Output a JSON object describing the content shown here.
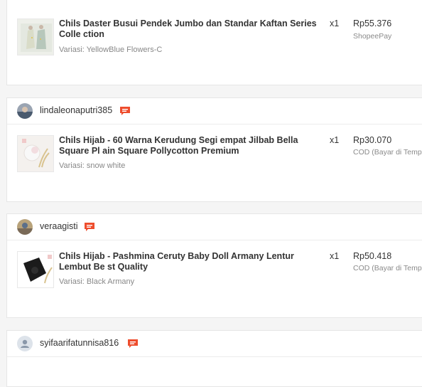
{
  "orders": [
    {
      "product_name": "Chils Daster Busui Pendek Jumbo dan Standar Kaftan Series Colle ction",
      "variant": "Variasi: YellowBlue Flowers-C",
      "qty": "x1",
      "price": "Rp55.376",
      "payment": "ShopeePay"
    },
    {
      "username": "lindaleonaputri385",
      "product_name": "Chils Hijab - 60 Warna Kerudung Segi empat Jilbab Bella Square Pl ain Square Pollycotton Premium",
      "variant": "Variasi: snow white",
      "qty": "x1",
      "price": "Rp30.070",
      "payment": "COD (Bayar di Tempat)"
    },
    {
      "username": "veraagisti",
      "product_name": "Chils Hijab - Pashmina Ceruty Baby Doll Armany Lentur Lembut Be st Quality",
      "variant": "Variasi: Black Armany",
      "qty": "x1",
      "price": "Rp50.418",
      "payment": "COD (Bayar di Tempat)"
    },
    {
      "username": "syifaarifatunnisa816"
    }
  ],
  "icons": {
    "chat": "chat-icon",
    "avatar_default": "user-silhouette-icon"
  },
  "colors": {
    "accent": "#ee4d2d",
    "background": "#f5f5f5",
    "card": "#ffffff"
  }
}
